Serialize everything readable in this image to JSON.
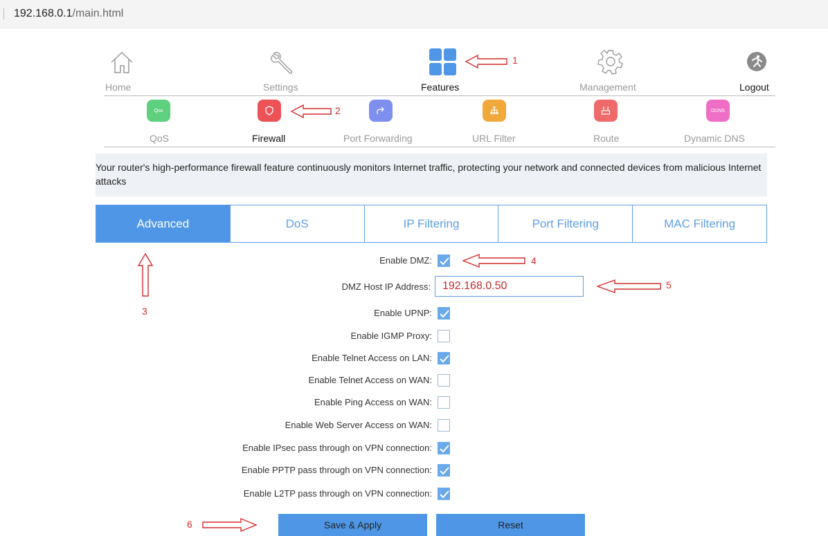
{
  "browser": {
    "url_host": "192.168.0.1",
    "url_path": "/main.html"
  },
  "nav": {
    "home": "Home",
    "settings": "Settings",
    "features": "Features",
    "management": "Management",
    "logout": "Logout"
  },
  "subnav": {
    "qos": {
      "label": "QoS",
      "icon_text": "Qos",
      "color": "#5fd07e"
    },
    "firewall": {
      "label": "Firewall",
      "color": "#ec5256"
    },
    "port_forwarding": {
      "label": "Port Forwarding",
      "color": "#7e8ff0"
    },
    "url_filter": {
      "label": "URL Filter",
      "color": "#f2a93b"
    },
    "route": {
      "label": "Route",
      "color": "#f06a6a"
    },
    "ddns": {
      "label": "Dynamic DNS",
      "icon_text": "DDNS",
      "color": "#f06fc6"
    }
  },
  "description": "Your router's high-performance firewall feature continuously monitors Internet traffic, protecting your network and connected devices from malicious Internet attacks",
  "tabs": {
    "advanced": "Advanced",
    "dos": "DoS",
    "ip_filtering": "IP Filtering",
    "port_filtering": "Port Filtering",
    "mac_filtering": "MAC Filtering"
  },
  "form": {
    "enable_dmz": {
      "label": "Enable DMZ:",
      "checked": true
    },
    "dmz_host_ip": {
      "label": "DMZ Host IP Address:",
      "value": "192.168.0.50"
    },
    "enable_upnp": {
      "label": "Enable UPNP:",
      "checked": true
    },
    "enable_igmp": {
      "label": "Enable IGMP Proxy:",
      "checked": false
    },
    "telnet_lan": {
      "label": "Enable Telnet Access on LAN:",
      "checked": true
    },
    "telnet_wan": {
      "label": "Enable Telnet Access on WAN:",
      "checked": false
    },
    "ping_wan": {
      "label": "Enable Ping Access on WAN:",
      "checked": false
    },
    "web_wan": {
      "label": "Enable Web Server Access on WAN:",
      "checked": false
    },
    "ipsec": {
      "label": "Enable IPsec pass through on VPN connection:",
      "checked": true
    },
    "pptp": {
      "label": "Enable PPTP pass through on VPN connection:",
      "checked": true
    },
    "l2tp": {
      "label": "Enable L2TP pass through on VPN connection:",
      "checked": true
    }
  },
  "buttons": {
    "save": "Save & Apply",
    "reset": "Reset"
  },
  "annotations": {
    "a1": "1",
    "a2": "2",
    "a3": "3",
    "a4": "4",
    "a5": "5",
    "a6": "6"
  },
  "colors": {
    "accent": "#4f97e6",
    "annotation": "#d42a2a"
  }
}
